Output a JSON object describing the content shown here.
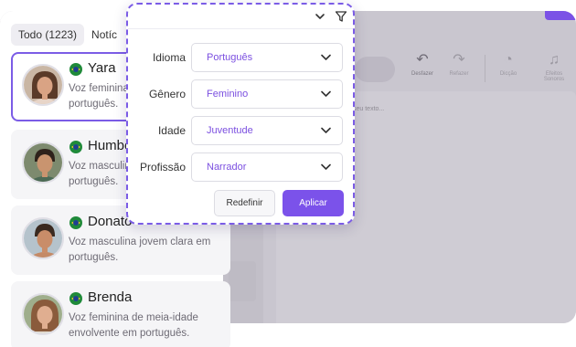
{
  "editor": {
    "tools": [
      {
        "label": "Desfazer",
        "icon": "undo-icon",
        "glyph": "↶"
      },
      {
        "label": "Refazer",
        "icon": "redo-icon",
        "glyph": "↷"
      },
      {
        "label": "Dicção",
        "icon": "diction-icon",
        "glyph": "◔"
      },
      {
        "label": "Efeitos Sonoros",
        "icon": "music-note-icon",
        "glyph": "♫"
      }
    ],
    "placeholder": "seu texto..."
  },
  "tabs": [
    {
      "label": "Todo (1223)",
      "active": true
    },
    {
      "label": "Notíc",
      "active": false
    }
  ],
  "voices": [
    {
      "name": "Yara",
      "desc": "Voz feminina jovem clara em português.",
      "selected": true,
      "country_flag": "brazil-flag-icon"
    },
    {
      "name": "Humberto",
      "desc": "Voz masculina jovem e envolvente em português.",
      "selected": false,
      "country_flag": "brazil-flag-icon"
    },
    {
      "name": "Donato",
      "desc": "Voz masculina jovem clara em português.",
      "selected": false,
      "country_flag": "brazil-flag-icon"
    },
    {
      "name": "Brenda",
      "desc": "Voz feminina de meia-idade envolvente em português.",
      "selected": false,
      "country_flag": "brazil-flag-icon"
    }
  ],
  "filter": {
    "fields": [
      {
        "label": "Idioma",
        "value": "Português"
      },
      {
        "label": "Gênero",
        "value": "Feminino"
      },
      {
        "label": "Idade",
        "value": "Juventude"
      },
      {
        "label": "Profissão",
        "value": "Narrador"
      }
    ],
    "reset_label": "Redefinir",
    "apply_label": "Aplicar"
  },
  "colors": {
    "accent": "#7b52ea",
    "value_text": "#7b4fe0",
    "overlay": "#c9c6cf"
  }
}
